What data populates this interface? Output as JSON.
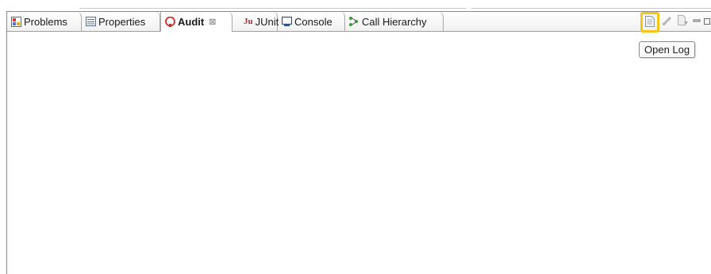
{
  "tabs": [
    {
      "label": "Problems",
      "icon": "problems-icon",
      "active": false
    },
    {
      "label": "Properties",
      "icon": "properties-icon",
      "active": false
    },
    {
      "label": "Audit",
      "icon": "audit-icon",
      "active": true,
      "close": "⊠"
    },
    {
      "label": "JUnit",
      "icon": "junit-icon",
      "active": false
    },
    {
      "label": "Console",
      "icon": "console-icon",
      "active": false
    },
    {
      "label": "Call Hierarchy",
      "icon": "call-hierarchy-icon",
      "active": false
    }
  ],
  "toolbar": {
    "buttons": [
      "open-log-icon",
      "edit-icon",
      "export-icon",
      "minimize-icon",
      "maximize-icon"
    ]
  },
  "tooltip": "Open Log",
  "colors": {
    "highlight": "#f5c518",
    "audit": "#d42a2a",
    "junit": "#b8322c"
  }
}
